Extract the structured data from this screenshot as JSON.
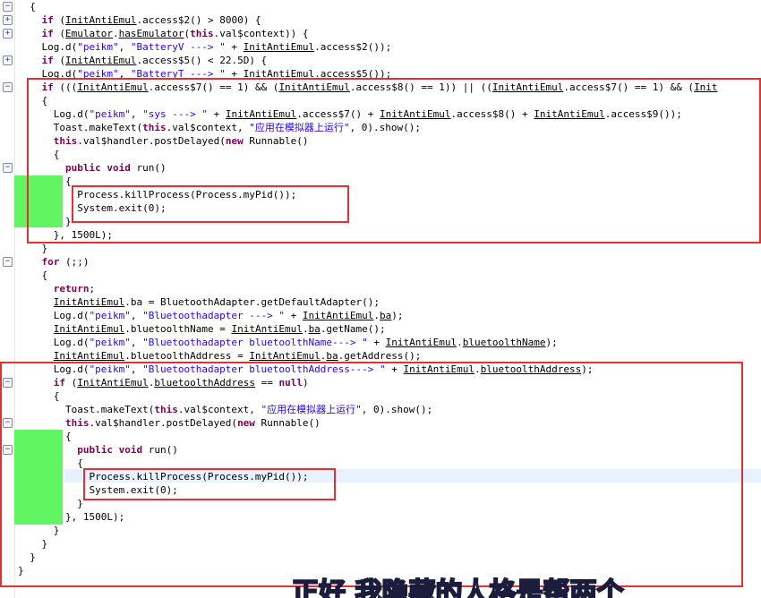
{
  "editor": {
    "lines": [
      [
        {
          "t": "  {"
        }
      ],
      [
        {
          "t": "    "
        },
        {
          "t": "if",
          "c": "kw"
        },
        {
          "t": " ("
        },
        {
          "t": "InitAntiEmul",
          "c": "ul"
        },
        {
          "t": ".access$2() > 8000) {"
        }
      ],
      [
        {
          "t": "    "
        },
        {
          "t": "if",
          "c": "kw"
        },
        {
          "t": " ("
        },
        {
          "t": "Emulator",
          "c": "ul"
        },
        {
          "t": "."
        },
        {
          "t": "hasEmulator",
          "c": "ul"
        },
        {
          "t": "("
        },
        {
          "t": "this",
          "c": "kw"
        },
        {
          "t": ".val$context)) {"
        }
      ],
      [
        {
          "t": "    Log.d("
        },
        {
          "t": "\"peikm\"",
          "c": "str"
        },
        {
          "t": ", "
        },
        {
          "t": "\"BatteryV ---> \"",
          "c": "str"
        },
        {
          "t": " + "
        },
        {
          "t": "InitAntiEmul",
          "c": "ul"
        },
        {
          "t": ".access$2());"
        }
      ],
      [
        {
          "t": "    "
        },
        {
          "t": "if",
          "c": "kw"
        },
        {
          "t": " ("
        },
        {
          "t": "InitAntiEmul",
          "c": "ul"
        },
        {
          "t": ".access$5() < 22.5D) {"
        }
      ],
      [
        {
          "t": "    Log.d("
        },
        {
          "t": "\"peikm\"",
          "c": "str"
        },
        {
          "t": ", "
        },
        {
          "t": "\"BatteryT ---> \"",
          "c": "str"
        },
        {
          "t": " + "
        },
        {
          "t": "InitAntiEmul",
          "c": "ul"
        },
        {
          "t": ".access$5());"
        }
      ],
      [
        {
          "t": "    "
        },
        {
          "t": "if",
          "c": "kw"
        },
        {
          "t": " ((("
        },
        {
          "t": "InitAntiEmul",
          "c": "ul"
        },
        {
          "t": ".access$7() == 1) && ("
        },
        {
          "t": "InitAntiEmul",
          "c": "ul"
        },
        {
          "t": ".access$8() == 1)) || (("
        },
        {
          "t": "InitAntiEmul",
          "c": "ul"
        },
        {
          "t": ".access$7() == 1) && ("
        },
        {
          "t": "Init",
          "c": "ul"
        }
      ],
      [
        {
          "t": "    {"
        }
      ],
      [
        {
          "t": "      Log.d("
        },
        {
          "t": "\"peikm\"",
          "c": "str"
        },
        {
          "t": ", "
        },
        {
          "t": "\"sys ---> \"",
          "c": "str"
        },
        {
          "t": " + "
        },
        {
          "t": "InitAntiEmul",
          "c": "ul"
        },
        {
          "t": ".access$7() + "
        },
        {
          "t": "InitAntiEmul",
          "c": "ul"
        },
        {
          "t": ".access$8() + "
        },
        {
          "t": "InitAntiEmul",
          "c": "ul"
        },
        {
          "t": ".access$9());"
        }
      ],
      [
        {
          "t": "      Toast.makeText("
        },
        {
          "t": "this",
          "c": "kw"
        },
        {
          "t": ".val$context, "
        },
        {
          "t": "\"应用在模拟器上运行\"",
          "c": "str"
        },
        {
          "t": ", 0).show();"
        }
      ],
      [
        {
          "t": "      "
        },
        {
          "t": "this",
          "c": "kw"
        },
        {
          "t": ".val$handler.postDelayed("
        },
        {
          "t": "new",
          "c": "kw"
        },
        {
          "t": " Runnable()"
        }
      ],
      [
        {
          "t": "      {"
        }
      ],
      [
        {
          "t": "        "
        },
        {
          "t": "public",
          "c": "kw"
        },
        {
          "t": " "
        },
        {
          "t": "void",
          "c": "kw"
        },
        {
          "t": " run()"
        }
      ],
      [
        {
          "t": "        {"
        }
      ],
      [
        {
          "t": "          Process.killProcess(Process.myPid());"
        }
      ],
      [
        {
          "t": "          System.exit(0);"
        }
      ],
      [
        {
          "t": "        }"
        }
      ],
      [
        {
          "t": "      }, 1500L);"
        }
      ],
      [
        {
          "t": "    }"
        }
      ],
      [
        {
          "t": "    "
        },
        {
          "t": "for",
          "c": "kw"
        },
        {
          "t": " (;;)"
        }
      ],
      [
        {
          "t": "    {"
        }
      ],
      [
        {
          "t": "      "
        },
        {
          "t": "return",
          "c": "kw"
        },
        {
          "t": ";"
        }
      ],
      [
        {
          "t": "      "
        },
        {
          "t": "InitAntiEmul",
          "c": "ul"
        },
        {
          "t": ".ba = BluetoothAdapter.getDefaultAdapter();"
        }
      ],
      [
        {
          "t": "      Log.d("
        },
        {
          "t": "\"peikm\"",
          "c": "str"
        },
        {
          "t": ", "
        },
        {
          "t": "\"Bluetoothadapter ---> \"",
          "c": "str"
        },
        {
          "t": " + "
        },
        {
          "t": "InitAntiEmul",
          "c": "ul"
        },
        {
          "t": "."
        },
        {
          "t": "ba",
          "c": "ul"
        },
        {
          "t": ");"
        }
      ],
      [
        {
          "t": "      "
        },
        {
          "t": "InitAntiEmul",
          "c": "ul"
        },
        {
          "t": ".bluetoolthName = "
        },
        {
          "t": "InitAntiEmul",
          "c": "ul"
        },
        {
          "t": "."
        },
        {
          "t": "ba",
          "c": "ul"
        },
        {
          "t": ".getName();"
        }
      ],
      [
        {
          "t": "      Log.d("
        },
        {
          "t": "\"peikm\"",
          "c": "str"
        },
        {
          "t": ", "
        },
        {
          "t": "\"Bluetoothadapter bluetoolthName---> \"",
          "c": "str"
        },
        {
          "t": " + "
        },
        {
          "t": "InitAntiEmul",
          "c": "ul"
        },
        {
          "t": "."
        },
        {
          "t": "bluetoolthName",
          "c": "ul"
        },
        {
          "t": ");"
        }
      ],
      [
        {
          "t": "      "
        },
        {
          "t": "InitAntiEmul",
          "c": "ul"
        },
        {
          "t": ".bluetoolthAddress = "
        },
        {
          "t": "InitAntiEmul",
          "c": "ul"
        },
        {
          "t": "."
        },
        {
          "t": "ba",
          "c": "ul"
        },
        {
          "t": ".getAddress();"
        }
      ],
      [
        {
          "t": "      Log.d("
        },
        {
          "t": "\"peikm\"",
          "c": "str"
        },
        {
          "t": ", "
        },
        {
          "t": "\"Bluetoothadapter bluetoolthAddress---> \"",
          "c": "str"
        },
        {
          "t": " + "
        },
        {
          "t": "InitAntiEmul",
          "c": "ul"
        },
        {
          "t": "."
        },
        {
          "t": "bluetoolthAddress",
          "c": "ul"
        },
        {
          "t": ");"
        }
      ],
      [
        {
          "t": "      "
        },
        {
          "t": "if",
          "c": "kw"
        },
        {
          "t": " ("
        },
        {
          "t": "InitAntiEmul",
          "c": "ul"
        },
        {
          "t": "."
        },
        {
          "t": "bluetoolthAddress",
          "c": "ul"
        },
        {
          "t": " == "
        },
        {
          "t": "null",
          "c": "kw"
        },
        {
          "t": ")"
        }
      ],
      [
        {
          "t": "      {"
        }
      ],
      [
        {
          "t": "        Toast.makeText("
        },
        {
          "t": "this",
          "c": "kw"
        },
        {
          "t": ".val$context, "
        },
        {
          "t": "\"应用在模拟器上运行\"",
          "c": "str"
        },
        {
          "t": ", 0).show();"
        }
      ],
      [
        {
          "t": "        "
        },
        {
          "t": "this",
          "c": "kw"
        },
        {
          "t": ".val$handler.postDelayed("
        },
        {
          "t": "new",
          "c": "kw"
        },
        {
          "t": " Runnable()"
        }
      ],
      [
        {
          "t": "        {"
        }
      ],
      [
        {
          "t": "          "
        },
        {
          "t": "public",
          "c": "kw"
        },
        {
          "t": " "
        },
        {
          "t": "void",
          "c": "kw"
        },
        {
          "t": " run()"
        }
      ],
      [
        {
          "t": "          {"
        }
      ],
      [
        {
          "t": "            Process.killProcess(Process.myPid());"
        }
      ],
      [
        {
          "t": "            System.exit(0);"
        }
      ],
      [
        {
          "t": "          }"
        }
      ],
      [
        {
          "t": "        }, 1500L);"
        }
      ],
      [
        {
          "t": "      }"
        }
      ],
      [
        {
          "t": "    }"
        }
      ],
      [
        {
          "t": "  }"
        }
      ],
      [
        {
          "t": "}"
        }
      ]
    ],
    "fold_markers": [
      {
        "line": 0,
        "sym": "−"
      },
      {
        "line": 1,
        "sym": "+"
      },
      {
        "line": 2,
        "sym": "+"
      },
      {
        "line": 4,
        "sym": "+"
      },
      {
        "line": 6,
        "sym": "−"
      },
      {
        "line": 12,
        "sym": "−"
      },
      {
        "line": 19,
        "sym": "−"
      },
      {
        "line": 28,
        "sym": "−"
      },
      {
        "line": 31,
        "sym": "−"
      },
      {
        "line": 33,
        "sym": "−"
      }
    ]
  },
  "overlay_text": "正好 我隐藏的人格是帮两个"
}
